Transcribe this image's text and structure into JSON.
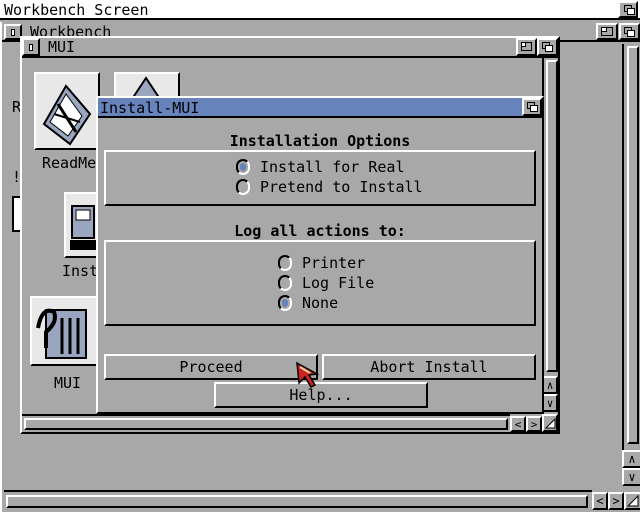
{
  "screen": {
    "title": "Workbench Screen"
  },
  "workbench_window": {
    "title": "Workbench",
    "partial_left_labels": [
      "R",
      "!"
    ]
  },
  "mui_window": {
    "title": "MUI"
  },
  "icons": [
    {
      "label": "ReadMe",
      "glyph": "document-icon"
    },
    {
      "label": "Instal",
      "glyph": "installer-icon"
    },
    {
      "label": "MUI",
      "glyph": "mui-drawer-icon"
    }
  ],
  "dialog": {
    "title": "Install-MUI",
    "installation_options": {
      "heading": "Installation Options",
      "options": [
        {
          "label": "Install for Real",
          "selected": true
        },
        {
          "label": "Pretend to Install",
          "selected": false
        }
      ]
    },
    "log_actions": {
      "heading": "Log all actions to:",
      "options": [
        {
          "label": "Printer",
          "selected": false
        },
        {
          "label": "Log File",
          "selected": false
        },
        {
          "label": "None",
          "selected": true
        }
      ]
    },
    "buttons": {
      "proceed": "Proceed",
      "abort": "Abort Install",
      "help": "Help..."
    }
  },
  "glyphs": {
    "up": "∧",
    "down": "∨",
    "left": "<",
    "right": ">"
  },
  "colors": {
    "background": "#a8a8a8",
    "title_bar": "#ffffff",
    "selection": "#6684bb",
    "pointer": "#cc2222"
  }
}
